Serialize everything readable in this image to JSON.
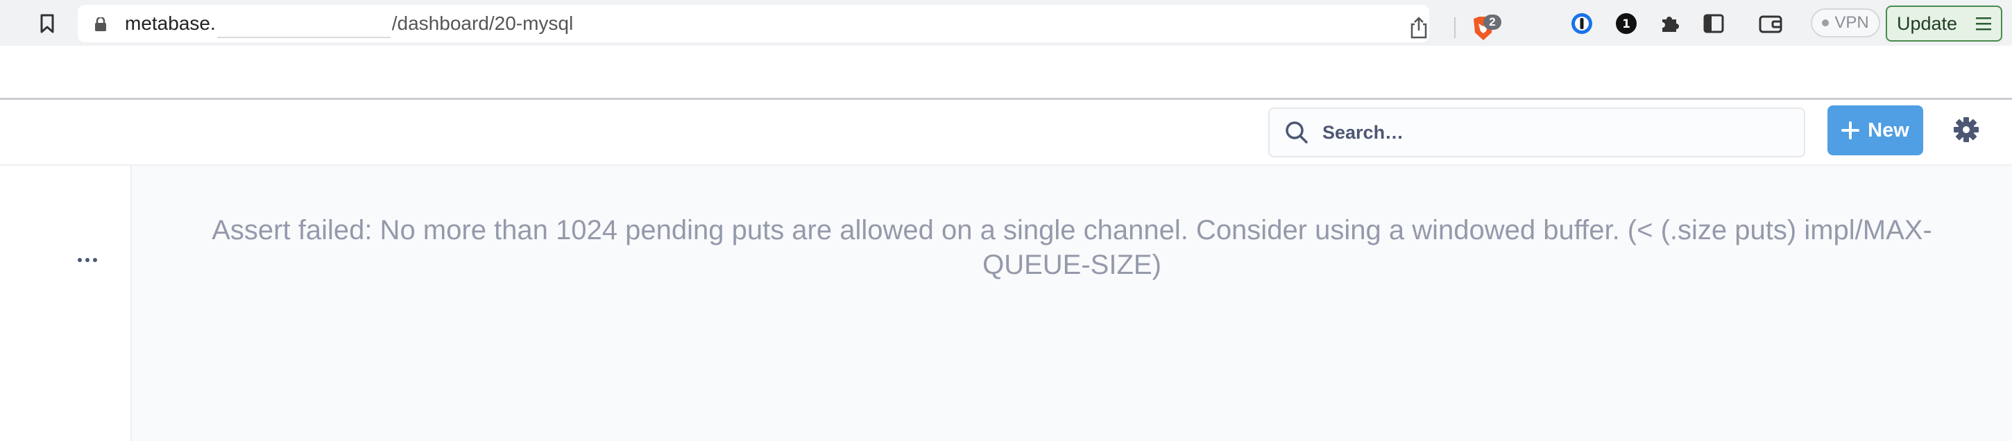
{
  "browser": {
    "url_host": "metabase.",
    "url_path": "/dashboard/20-mysql",
    "brave_badge_count": "2",
    "vpn_label": "VPN",
    "update_label": "Update"
  },
  "header": {
    "search_placeholder": "Search…",
    "new_label": "New"
  },
  "main": {
    "error_message": "Assert failed: No more than 1024 pending puts are allowed on a single channel. Consider using a windowed buffer. (< (.size puts) impl/MAX-QUEUE-SIZE)"
  },
  "colors": {
    "accent": "#509ee3",
    "error_text": "#949aab"
  }
}
